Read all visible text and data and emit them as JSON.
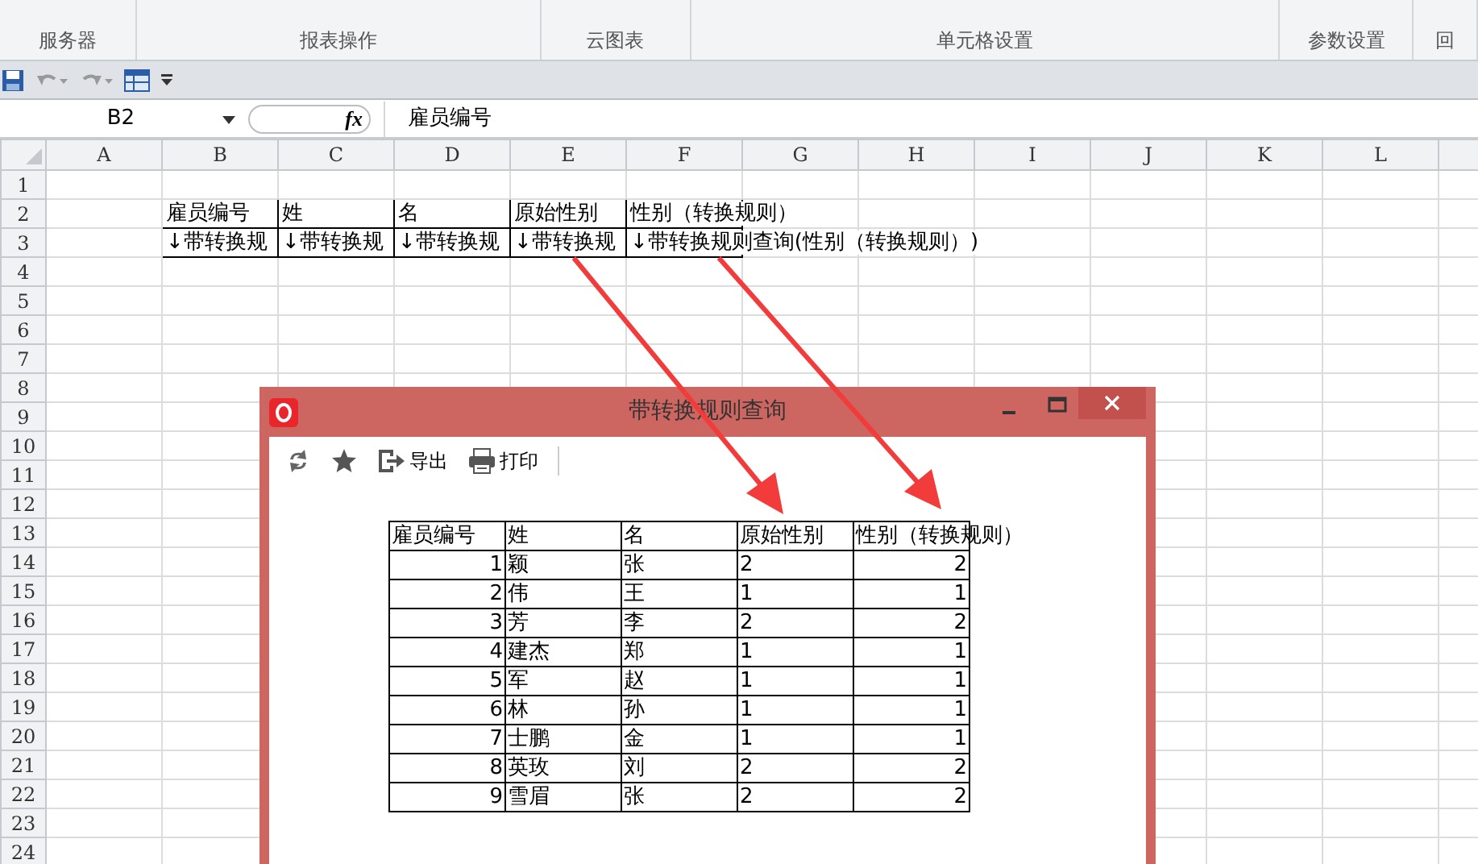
{
  "ribbon": {
    "groups": [
      "服务器",
      "报表操作",
      "云图表",
      "单元格设置",
      "参数设置",
      "回"
    ]
  },
  "formula_bar": {
    "name_box": "B2",
    "function_label": "fx",
    "value": "雇员编号"
  },
  "sheet": {
    "columns": [
      "A",
      "B",
      "C",
      "D",
      "E",
      "F",
      "G",
      "H",
      "I",
      "J",
      "K",
      "L"
    ],
    "rows": [
      "1",
      "2",
      "3",
      "4",
      "5",
      "6",
      "7",
      "8",
      "9",
      "10",
      "11",
      "12",
      "13",
      "14",
      "15",
      "16",
      "17",
      "18",
      "19",
      "20",
      "21",
      "22",
      "23",
      "24"
    ],
    "header_row": [
      "雇员编号",
      "姓",
      "名",
      "原始性别",
      "性别（转换规则）"
    ],
    "query_row": [
      "↓带转换规",
      "↓带转换规",
      "↓带转换规",
      "↓带转换规",
      "↓带转换规则查询(性别（转换规则）)"
    ]
  },
  "dialog": {
    "title": "带转换规则查询",
    "toolbar": [
      {
        "kind": "refresh"
      },
      {
        "kind": "favorite"
      },
      {
        "kind": "export",
        "label": "导出"
      },
      {
        "kind": "print",
        "label": "打印"
      }
    ],
    "table": {
      "columns": [
        "雇员编号",
        "姓",
        "名",
        "原始性别",
        "性别（转换规则）"
      ],
      "rows": [
        [
          "1",
          "颖",
          "张",
          "2",
          "2"
        ],
        [
          "2",
          "伟",
          "王",
          "1",
          "1"
        ],
        [
          "3",
          "芳",
          "李",
          "2",
          "2"
        ],
        [
          "4",
          "建杰",
          "郑",
          "1",
          "1"
        ],
        [
          "5",
          "军",
          "赵",
          "1",
          "1"
        ],
        [
          "6",
          "林",
          "孙",
          "1",
          "1"
        ],
        [
          "7",
          "士鹏",
          "金",
          "1",
          "1"
        ],
        [
          "8",
          "英玫",
          "刘",
          "2",
          "2"
        ],
        [
          "9",
          "雪眉",
          "张",
          "2",
          "2"
        ]
      ]
    }
  }
}
